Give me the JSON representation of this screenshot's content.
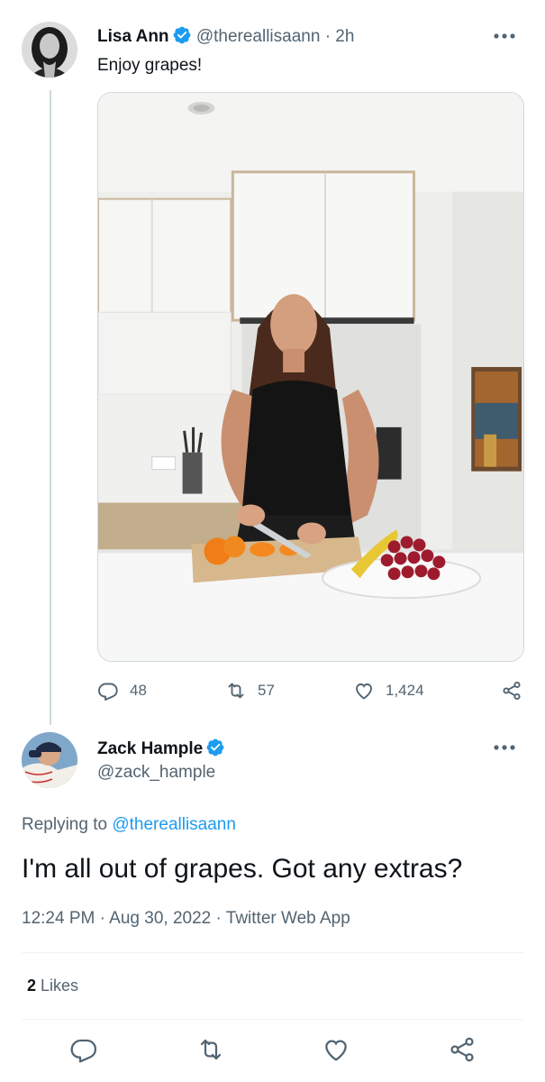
{
  "tweet": {
    "author_name": "Lisa Ann",
    "handle": "@thereallisaann",
    "separator": "·",
    "time_ago": "2h",
    "text": "Enjoy grapes!",
    "actions": {
      "replies": "48",
      "retweets": "57",
      "likes": "1,424"
    }
  },
  "reply": {
    "author_name": "Zack Hample",
    "handle": "@zack_hample",
    "replying_to_prefix": "Replying to",
    "replying_to_handle": "@thereallisaann",
    "text": "I'm all out of grapes. Got any extras?",
    "time": "12:24 PM",
    "date": "Aug 30, 2022",
    "source": "Twitter Web App",
    "separator": "·",
    "likes_count": "2",
    "likes_label": "Likes"
  },
  "icons": {
    "verified": "verified-badge-icon",
    "more": "more-options-icon",
    "reply": "reply-icon",
    "retweet": "retweet-icon",
    "like": "heart-icon",
    "share": "share-icon"
  },
  "colors": {
    "accent": "#1d9bf0",
    "text": "#0f1419",
    "muted": "#536471",
    "border": "#cfd9de"
  }
}
